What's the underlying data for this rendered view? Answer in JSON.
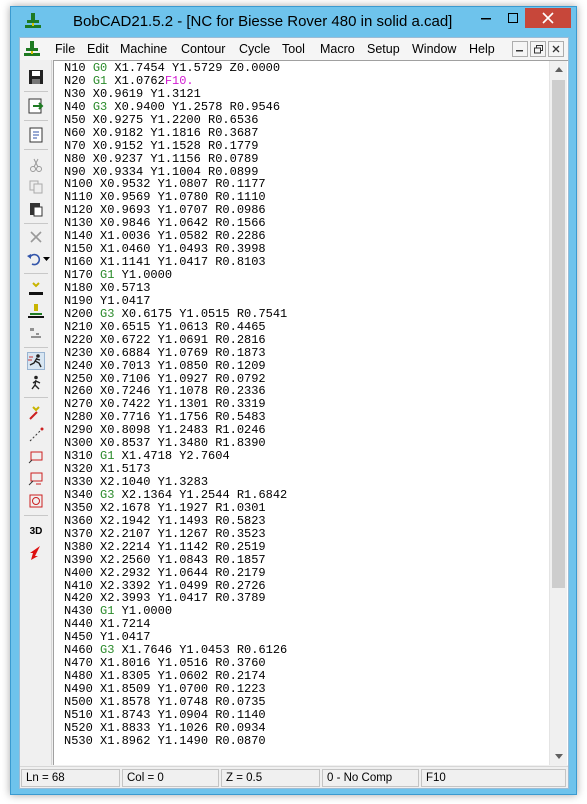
{
  "window": {
    "title": "BobCAD21.5.2 - [NC for Biesse Rover 480 in solid a.cad]",
    "close_color": "#c7473a",
    "frame_color": "#6ec3ec"
  },
  "menu": {
    "items": [
      "File",
      "Edit",
      "Machine",
      "Contour",
      "Cycle",
      "Tool",
      "Macro",
      "Setup",
      "Window",
      "Help"
    ]
  },
  "toolbar": {
    "icons": [
      "save-icon",
      "export-icon",
      "document-icon",
      "cut-icon",
      "copy-icon",
      "paste-icon",
      "delete-icon",
      "undo-icon",
      "dropdown-icon",
      "tool-path-icon",
      "tool-select-icon",
      "step-icon",
      "run-icon",
      "walk-icon",
      "wire-icon",
      "dashed-line-icon",
      "rectangle-icon",
      "rectangle-arrow-icon",
      "rectangle-circle-icon",
      "3d-icon",
      "red-arrow-icon"
    ],
    "label_3d": "3D"
  },
  "code_lines": [
    [
      [
        "N10 ",
        ""
      ],
      [
        "G0",
        "g"
      ],
      [
        " X1.7454 Y1.5729 Z0.0000",
        ""
      ]
    ],
    [
      [
        "N20 ",
        ""
      ],
      [
        "G1",
        "g"
      ],
      [
        " X1.0762",
        ""
      ],
      [
        "F10.",
        "f"
      ]
    ],
    [
      [
        "N30 X0.9619 Y1.3121",
        ""
      ]
    ],
    [
      [
        "N40 ",
        ""
      ],
      [
        "G3",
        "g"
      ],
      [
        " X0.9400 Y1.2578 R0.9546",
        ""
      ]
    ],
    [
      [
        "N50 X0.9275 Y1.2200 R0.6536",
        ""
      ]
    ],
    [
      [
        "N60 X0.9182 Y1.1816 R0.3687",
        ""
      ]
    ],
    [
      [
        "N70 X0.9152 Y1.1528 R0.1779",
        ""
      ]
    ],
    [
      [
        "N80 X0.9237 Y1.1156 R0.0789",
        ""
      ]
    ],
    [
      [
        "N90 X0.9334 Y1.1004 R0.0899",
        ""
      ]
    ],
    [
      [
        "N100 X0.9532 Y1.0807 R0.1177",
        ""
      ]
    ],
    [
      [
        "N110 X0.9569 Y1.0780 R0.1110",
        ""
      ]
    ],
    [
      [
        "N120 X0.9693 Y1.0707 R0.0986",
        ""
      ]
    ],
    [
      [
        "N130 X0.9846 Y1.0642 R0.1566",
        ""
      ]
    ],
    [
      [
        "N140 X1.0036 Y1.0582 R0.2286",
        ""
      ]
    ],
    [
      [
        "N150 X1.0460 Y1.0493 R0.3998",
        ""
      ]
    ],
    [
      [
        "N160 X1.1141 Y1.0417 R0.8103",
        ""
      ]
    ],
    [
      [
        "N170 ",
        ""
      ],
      [
        "G1",
        "g"
      ],
      [
        " Y1.0000",
        ""
      ]
    ],
    [
      [
        "N180 X0.5713",
        ""
      ]
    ],
    [
      [
        "N190 Y1.0417",
        ""
      ]
    ],
    [
      [
        "N200 ",
        ""
      ],
      [
        "G3",
        "g"
      ],
      [
        " X0.6175 Y1.0515 R0.7541",
        ""
      ]
    ],
    [
      [
        "N210 X0.6515 Y1.0613 R0.4465",
        ""
      ]
    ],
    [
      [
        "N220 X0.6722 Y1.0691 R0.2816",
        ""
      ]
    ],
    [
      [
        "N230 X0.6884 Y1.0769 R0.1873",
        ""
      ]
    ],
    [
      [
        "N240 X0.7013 Y1.0850 R0.1209",
        ""
      ]
    ],
    [
      [
        "N250 X0.7106 Y1.0927 R0.0792",
        ""
      ]
    ],
    [
      [
        "N260 X0.7246 Y1.1078 R0.2336",
        ""
      ]
    ],
    [
      [
        "N270 X0.7422 Y1.1301 R0.3319",
        ""
      ]
    ],
    [
      [
        "N280 X0.7716 Y1.1756 R0.5483",
        ""
      ]
    ],
    [
      [
        "N290 X0.8098 Y1.2483 R1.0246",
        ""
      ]
    ],
    [
      [
        "N300 X0.8537 Y1.3480 R1.8390",
        ""
      ]
    ],
    [
      [
        "N310 ",
        ""
      ],
      [
        "G1",
        "g"
      ],
      [
        " X1.4718 Y2.7604",
        ""
      ]
    ],
    [
      [
        "N320 X1.5173",
        ""
      ]
    ],
    [
      [
        "N330 X2.1040 Y1.3283",
        ""
      ]
    ],
    [
      [
        "N340 ",
        ""
      ],
      [
        "G3",
        "g"
      ],
      [
        " X2.1364 Y1.2544 R1.6842",
        ""
      ]
    ],
    [
      [
        "N350 X2.1678 Y1.1927 R1.0301",
        ""
      ]
    ],
    [
      [
        "N360 X2.1942 Y1.1493 R0.5823",
        ""
      ]
    ],
    [
      [
        "N370 X2.2107 Y1.1267 R0.3523",
        ""
      ]
    ],
    [
      [
        "N380 X2.2214 Y1.1142 R0.2519",
        ""
      ]
    ],
    [
      [
        "N390 X2.2560 Y1.0843 R0.1857",
        ""
      ]
    ],
    [
      [
        "N400 X2.2932 Y1.0644 R0.2179",
        ""
      ]
    ],
    [
      [
        "N410 X2.3392 Y1.0499 R0.2726",
        ""
      ]
    ],
    [
      [
        "N420 X2.3993 Y1.0417 R0.3789",
        ""
      ]
    ],
    [
      [
        "N430 ",
        ""
      ],
      [
        "G1",
        "g"
      ],
      [
        " Y1.0000",
        ""
      ]
    ],
    [
      [
        "N440 X1.7214",
        ""
      ]
    ],
    [
      [
        "N450 Y1.0417",
        ""
      ]
    ],
    [
      [
        "N460 ",
        ""
      ],
      [
        "G3",
        "g"
      ],
      [
        " X1.7646 Y1.0453 R0.6126",
        ""
      ]
    ],
    [
      [
        "N470 X1.8016 Y1.0516 R0.3760",
        ""
      ]
    ],
    [
      [
        "N480 X1.8305 Y1.0602 R0.2174",
        ""
      ]
    ],
    [
      [
        "N490 X1.8509 Y1.0700 R0.1223",
        ""
      ]
    ],
    [
      [
        "N500 X1.8578 Y1.0748 R0.0735",
        ""
      ]
    ],
    [
      [
        "N510 X1.8743 Y1.0904 R0.1140",
        ""
      ]
    ],
    [
      [
        "N520 X1.8833 Y1.1026 R0.0934",
        ""
      ]
    ],
    [
      [
        "N530 X1.8962 Y1.1490 R0.0870",
        ""
      ]
    ]
  ],
  "code_colors": {
    "g": "#2a8a2a",
    "f": "#d21cd2"
  },
  "status": {
    "line": "Ln = 68",
    "col": "Col = 0",
    "z": "Z = 0.5",
    "comp": "0 - No Comp",
    "feed": "F10"
  }
}
